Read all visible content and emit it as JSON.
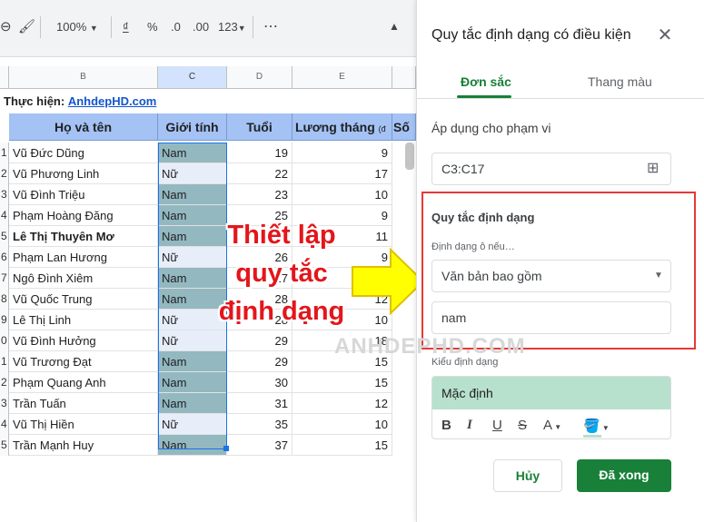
{
  "toolbar": {
    "zoom": "100%",
    "currency": "₫",
    "percent": "%",
    "dec_decrease": ".0",
    "dec_increase": ".00",
    "number_format": "123",
    "more": "⋯"
  },
  "sheet": {
    "col_headers": [
      "B",
      "C",
      "D",
      "E"
    ],
    "credit_label": "Thực hiện:",
    "credit_link": "AnhdepHD.com",
    "headers": [
      "Họ và tên",
      "Giới tính",
      "Tuổi",
      "Lương tháng",
      "(đ",
      "Số"
    ],
    "rows": [
      {
        "n": "1",
        "name": "Vũ Đức Dũng",
        "gender": "Nam",
        "age": "19",
        "salary": "9"
      },
      {
        "n": "2",
        "name": "Vũ Phương Linh",
        "gender": "Nữ",
        "age": "22",
        "salary": "17"
      },
      {
        "n": "3",
        "name": "Vũ Đình Triệu",
        "gender": "Nam",
        "age": "23",
        "salary": "10"
      },
      {
        "n": "4",
        "name": "Phạm Hoàng Đăng",
        "gender": "Nam",
        "age": "25",
        "salary": "9"
      },
      {
        "n": "5",
        "name": "Lê Thị Thuyên Mơ",
        "gender": "Nam",
        "age": "25",
        "salary": "11"
      },
      {
        "n": "6",
        "name": "Phạm Lan Hương",
        "gender": "Nữ",
        "age": "26",
        "salary": "9"
      },
      {
        "n": "7",
        "name": "Ngô Đình Xiêm",
        "gender": "Nam",
        "age": "27",
        "salary": "7"
      },
      {
        "n": "8",
        "name": "Vũ Quốc Trung",
        "gender": "Nam",
        "age": "28",
        "salary": "12"
      },
      {
        "n": "9",
        "name": "Lê Thị Linh",
        "gender": "Nữ",
        "age": "28",
        "salary": "10"
      },
      {
        "n": "0",
        "name": "Vũ Đình Hưởng",
        "gender": "Nữ",
        "age": "29",
        "salary": "18"
      },
      {
        "n": "1",
        "name": "Vũ Trương Đạt",
        "gender": "Nam",
        "age": "29",
        "salary": "15"
      },
      {
        "n": "2",
        "name": "Phạm Quang Anh",
        "gender": "Nam",
        "age": "30",
        "salary": "15"
      },
      {
        "n": "3",
        "name": "Trần Tuấn",
        "gender": "Nam",
        "age": "31",
        "salary": "12"
      },
      {
        "n": "4",
        "name": "Vũ Thị Hiền",
        "gender": "Nữ",
        "age": "35",
        "salary": "10"
      },
      {
        "n": "5",
        "name": "Trần Mạnh Huy",
        "gender": "Nam",
        "age": "37",
        "salary": "15"
      }
    ]
  },
  "panel": {
    "title": "Quy tắc định dạng có điều kiện",
    "tabs": [
      "Đơn sắc",
      "Thang màu"
    ],
    "range_label": "Áp dụng cho phạm vi",
    "range_value": "C3:C17",
    "rules_label": "Quy tắc định dạng",
    "condition_label": "Định dạng ô nếu…",
    "condition_value": "Văn bản bao gồm",
    "value_input": "nam",
    "style_label": "Kiểu định dạng",
    "style_preview": "Mặc định",
    "format_buttons": [
      "B",
      "I",
      "U",
      "S",
      "A"
    ],
    "cancel": "Hủy",
    "done": "Đã xong"
  },
  "callout": {
    "lines": [
      "Thiết lập",
      "quy tắc",
      "định dạng"
    ]
  },
  "watermark": "ANHDEPHD.COM",
  "colors": {
    "accent": "#188038",
    "header_fill": "#a4c2f4",
    "highlight_fill": "#93b8c0",
    "callout_red": "#e3161b",
    "arrow_yellow": "#ffff00",
    "preview_fill": "#b7e1cd"
  }
}
